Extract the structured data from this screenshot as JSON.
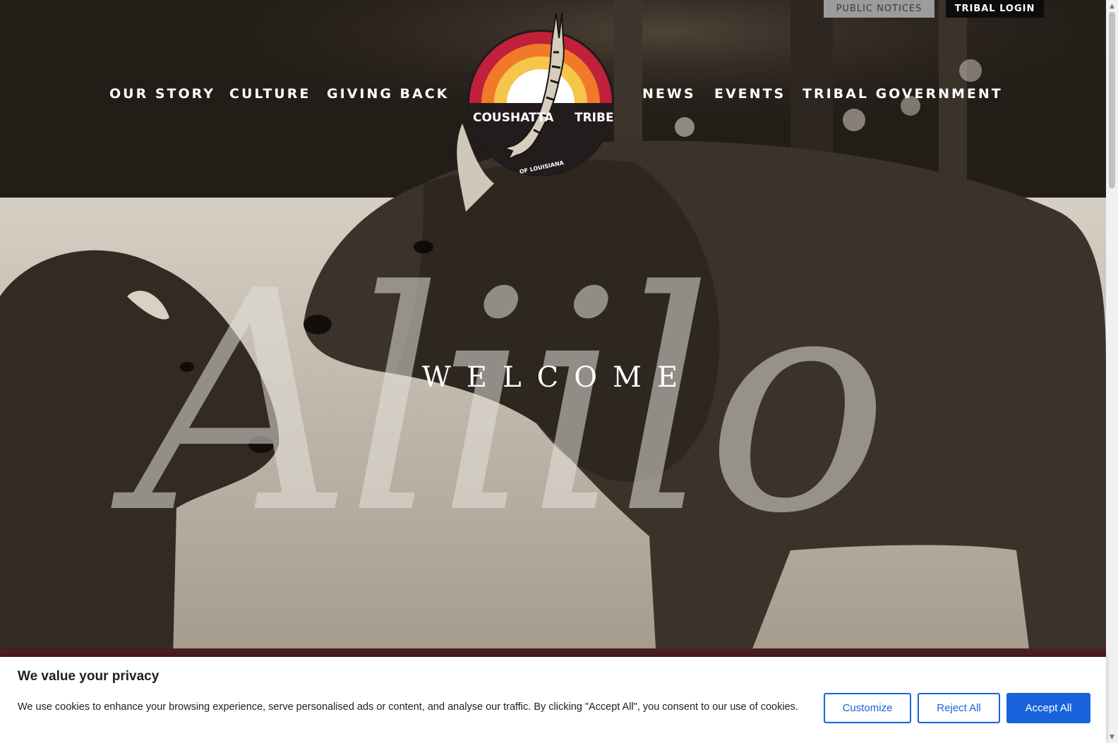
{
  "top_bar": {
    "public_notices": "PUBLIC NOTICES",
    "tribal_login": "TRIBAL LOGIN"
  },
  "nav": {
    "left": [
      "OUR STORY",
      "CULTURE",
      "GIVING BACK"
    ],
    "right": [
      "NEWS",
      "EVENTS",
      "TRIBAL GOVERNMENT"
    ]
  },
  "logo": {
    "word_left": "COUSHATTA",
    "word_right": "TRIBE",
    "subtitle": "OF LOUISIANA"
  },
  "hero": {
    "script_word": "Aliilo",
    "welcome": "WELCOME"
  },
  "cookie_banner": {
    "title": "We value your privacy",
    "text": "We use cookies to enhance your browsing experience, serve personalised ads or content, and analyse our traffic. By clicking \"Accept All\", you consent to our use of cookies.",
    "customize": "Customize",
    "reject": "Reject All",
    "accept": "Accept All"
  },
  "colors": {
    "accept_blue": "#1863dc",
    "logo_red": "#c0203a",
    "logo_orange": "#f07a2a",
    "logo_yellow": "#f6c64a",
    "band_maroon": "#4a1e22"
  }
}
